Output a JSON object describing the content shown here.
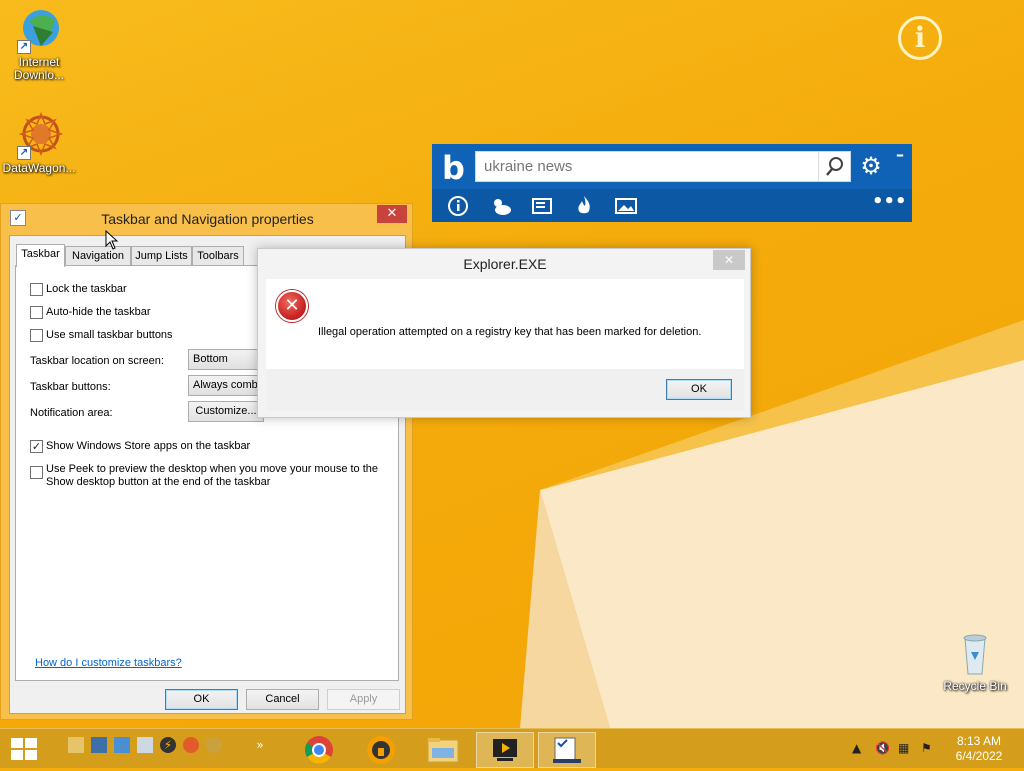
{
  "desktop": {
    "icons": [
      {
        "label": "Internet Downlo..."
      },
      {
        "label": "DataWagon..."
      },
      {
        "label": "Recycle Bin"
      }
    ],
    "info_glyph": "i"
  },
  "bing_bar": {
    "logo_glyph": "b",
    "search_value": "ukraine news",
    "tools": [
      "info-icon",
      "weather-icon",
      "news-icon",
      "trending-icon",
      "images-icon"
    ],
    "more_glyph": "•••"
  },
  "taskbar_props": {
    "title": "Taskbar and Navigation properties",
    "tabs": [
      "Taskbar",
      "Navigation",
      "Jump Lists",
      "Toolbars"
    ],
    "active_tab": "Taskbar",
    "checkboxes": {
      "lock": {
        "label": "Lock the taskbar",
        "checked": false
      },
      "autohide": {
        "label": "Auto-hide the taskbar",
        "checked": false
      },
      "small": {
        "label": "Use small taskbar buttons",
        "checked": false
      },
      "store_apps": {
        "label": "Show Windows Store apps on the taskbar",
        "checked": true
      },
      "peek": {
        "label": "Use Peek to preview the desktop when you move your mouse to the Show desktop button at the end of the taskbar",
        "checked": false
      }
    },
    "location_label": "Taskbar location on screen:",
    "location_value": "Bottom",
    "buttons_label": "Taskbar buttons:",
    "buttons_value": "Always combin",
    "notification_label": "Notification area:",
    "customize_label": "Customize...",
    "help_link": "How do I customize taskbars?",
    "ok_label": "OK",
    "cancel_label": "Cancel",
    "apply_label": "Apply"
  },
  "error_dialog": {
    "title": "Explorer.EXE",
    "message": "Illegal operation attempted on a registry key that has been marked for deletion.",
    "ok_label": "OK"
  },
  "taskbar": {
    "clock_time": "8:13 AM",
    "clock_date": "6/4/2022"
  },
  "colors": {
    "desktop_bg": "#f5ad0a",
    "bing_blue": "#0f62b5",
    "taskbar": "#d49e1c",
    "error_red": "#c41d1d"
  }
}
